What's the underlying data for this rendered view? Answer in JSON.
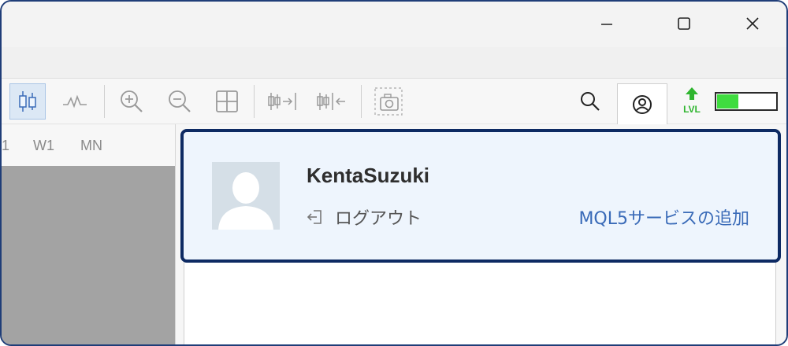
{
  "window": {
    "controls": {
      "minimize": "minimize-icon",
      "maximize": "maximize-icon",
      "close": "close-icon"
    }
  },
  "toolbar": {
    "buttons": [
      {
        "name": "candlestick-chart-icon",
        "active": true
      },
      {
        "name": "line-chart-icon",
        "active": false
      },
      {
        "name": "zoom-in-icon",
        "active": false
      },
      {
        "name": "zoom-out-icon",
        "active": false
      },
      {
        "name": "tile-windows-icon",
        "active": false
      },
      {
        "name": "chart-shift-icon",
        "active": false
      },
      {
        "name": "auto-scroll-icon",
        "active": false
      },
      {
        "name": "screenshot-icon",
        "active": false
      },
      {
        "name": "search-icon",
        "active": false
      },
      {
        "name": "account-icon",
        "active": true
      },
      {
        "name": "lvl-icon",
        "active": false
      }
    ],
    "lvl_label": "LVL",
    "lvl_fill_fraction": 0.37,
    "lvl_color": "#3fdc3f"
  },
  "periods": [
    "1",
    "W1",
    "MN"
  ],
  "account": {
    "username": "KentaSuzuki",
    "logout_label": "ログアウト",
    "add_service_label": "MQL5サービスの追加",
    "link_color": "#3a6bb8",
    "highlight_border_color": "#0d2a63"
  }
}
